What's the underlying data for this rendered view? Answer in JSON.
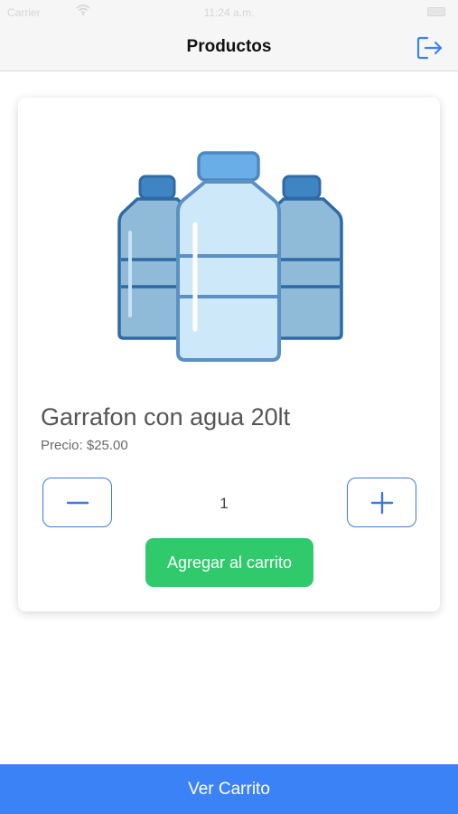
{
  "status_bar": {
    "carrier": "Carrier",
    "time": "11:24 a.m."
  },
  "nav": {
    "title": "Productos",
    "logout_icon": "logout-icon"
  },
  "product": {
    "name": "Garrafon con agua 20lt",
    "price": "Precio: $25.00",
    "quantity": "1",
    "image_icon": "water-bottles-icon"
  },
  "actions": {
    "add_to_cart": "Agregar al carrito",
    "view_cart": "Ver Carrito",
    "decrement_icon": "minus-icon",
    "increment_icon": "plus-icon"
  },
  "colors": {
    "accent_blue": "#3b82f6",
    "outline_blue": "#3d7bd9",
    "success_green": "#30c96b"
  }
}
